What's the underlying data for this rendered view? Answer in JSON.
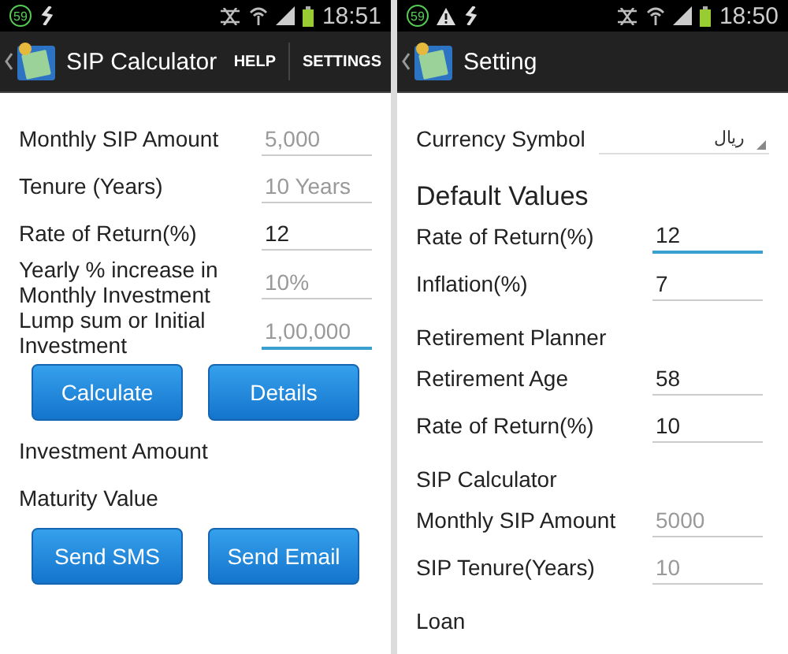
{
  "screens": [
    {
      "status_bar": {
        "badge": "59",
        "warning": false,
        "time": "18:51"
      },
      "title": "SIP Calculator",
      "actions": [
        "HELP",
        "SETTINGS"
      ],
      "items": [
        {
          "kind": "field",
          "label": "Monthly SIP Amount",
          "placeholder": "5,000",
          "focused": false
        },
        {
          "kind": "field",
          "label": "Tenure (Years)",
          "placeholder": "10 Years",
          "focused": false
        },
        {
          "kind": "field",
          "label": "Rate of Return(%)",
          "value": "12",
          "focused": false
        },
        {
          "kind": "field",
          "label": "Yearly % increase in Monthly Investment",
          "placeholder": "10%",
          "focused": false
        },
        {
          "kind": "field",
          "label": "Lump sum or Initial Investment",
          "placeholder": "1,00,000",
          "focused": true
        },
        {
          "kind": "buttons",
          "buttons": [
            "Calculate",
            "Details"
          ]
        },
        {
          "kind": "text",
          "label": "Investment Amount"
        },
        {
          "kind": "text",
          "label": "Maturity Value"
        },
        {
          "kind": "buttons",
          "buttons": [
            "Send SMS",
            "Send Email"
          ]
        }
      ]
    },
    {
      "status_bar": {
        "badge": "59",
        "warning": true,
        "time": "18:50"
      },
      "title": "Setting",
      "items": [
        {
          "kind": "select",
          "label": "Currency Symbol",
          "value": "ریال"
        },
        {
          "kind": "heading",
          "label": "Default Values"
        },
        {
          "kind": "field",
          "label": "Rate of Return(%)",
          "value": "12",
          "focused": true
        },
        {
          "kind": "field",
          "label": "Inflation(%)",
          "value": "7",
          "focused": false
        },
        {
          "kind": "subheading",
          "label": "Retirement Planner"
        },
        {
          "kind": "field",
          "label": "Retirement Age",
          "value": "58",
          "focused": false
        },
        {
          "kind": "field",
          "label": "Rate of Return(%)",
          "value": "10",
          "focused": false
        },
        {
          "kind": "subheading",
          "label": "SIP Calculator"
        },
        {
          "kind": "field",
          "label": "Monthly SIP Amount",
          "placeholder": "5000",
          "focused": false
        },
        {
          "kind": "field",
          "label": "SIP Tenure(Years)",
          "placeholder": "10",
          "focused": false
        },
        {
          "kind": "subheading",
          "label": "Loan"
        }
      ]
    }
  ]
}
